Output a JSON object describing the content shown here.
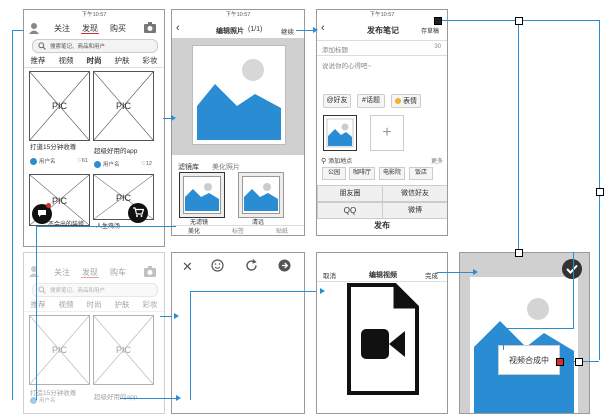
{
  "colors": {
    "accent": "#2a8dd4",
    "tab_underline": "#d0302f",
    "frame": "#9a9a9a"
  },
  "status": {
    "time": "下午10:57"
  },
  "feed": {
    "tabs": [
      "关注",
      "发现",
      "购买"
    ],
    "search_placeholder": "搜索笔记、商品和用户",
    "categories": [
      "推荐",
      "视频",
      "时尚",
      "护肤",
      "彩妆"
    ],
    "pic_label": "PIC",
    "cards": [
      {
        "title": "打道15分钟收尊",
        "user": "用户名",
        "likes": "61"
      },
      {
        "title": "超级好用的app",
        "user": "用户名",
        "likes": "12"
      },
      {
        "title": "不会出的装修",
        "user": "",
        "likes": ""
      },
      {
        "title": "人生鸡汤",
        "user": "",
        "likes": ""
      }
    ]
  },
  "feed2": {
    "tabs": [
      "关注",
      "发现",
      "购车"
    ],
    "search_placeholder": "搜索笔记、商品和用户",
    "categories": [
      "推荐",
      "视频",
      "时尚",
      "护肤",
      "彩妆"
    ],
    "pic_label": "PIC",
    "cards": [
      {
        "title": "打造15分钟收尊",
        "user": "用户名",
        "likes": ""
      },
      {
        "title": "超级好用的app",
        "user": "",
        "likes": ""
      }
    ]
  },
  "edit_photo": {
    "title": "编辑照片",
    "count": "(1/1)",
    "next": "继续",
    "filter_tabs": [
      "滤镜库",
      "美化照片"
    ],
    "filters": [
      "无滤镜",
      "清远"
    ],
    "bottom_tabs": [
      "美化",
      "标签",
      "贴纸"
    ]
  },
  "publish": {
    "title": "发布笔记",
    "save_draft": "存草稿",
    "title_placeholder": "添加标题",
    "title_limit": "30",
    "content_placeholder": "说说你的心得吧~",
    "chips": [
      "@好友",
      "#话题",
      "表情"
    ],
    "add_location": "添加地点",
    "more": "更多",
    "locations": [
      "公园",
      "咖啡厅",
      "电影院",
      "饭店"
    ],
    "share": [
      "朋友圈",
      "微信好友",
      "QQ",
      "微博"
    ],
    "publish_button": "发布"
  },
  "edit_video": {
    "cancel": "取消",
    "title": "编辑视频",
    "done": "完成"
  },
  "toolbar_icons": [
    "close-icon",
    "emoji-icon",
    "refresh-icon",
    "forward-icon"
  ],
  "toast": {
    "message": "视频合成中"
  }
}
